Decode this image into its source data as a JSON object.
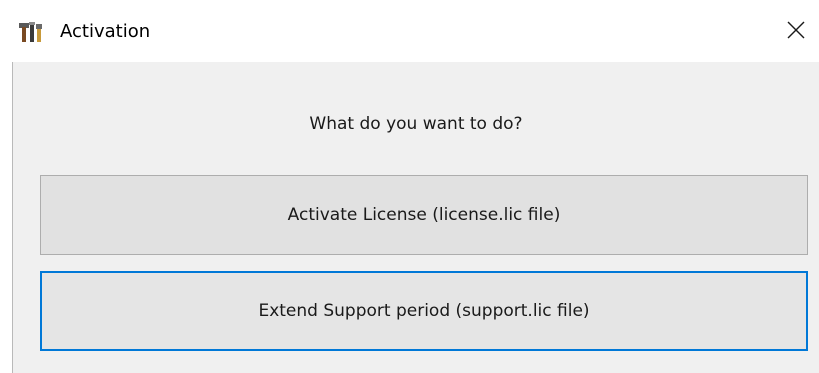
{
  "window": {
    "title": "Activation"
  },
  "icons": {
    "app": "tools-hammer-icon",
    "close": "close-icon"
  },
  "dialog": {
    "prompt": "What do you want to do?",
    "buttons": {
      "activate": "Activate License (license.lic file)",
      "extend": "Extend Support period (support.lic file)"
    }
  },
  "colors": {
    "focus_border": "#0078d7",
    "button_bg": "#e1e1e1",
    "client_bg": "#f0f0f0"
  }
}
